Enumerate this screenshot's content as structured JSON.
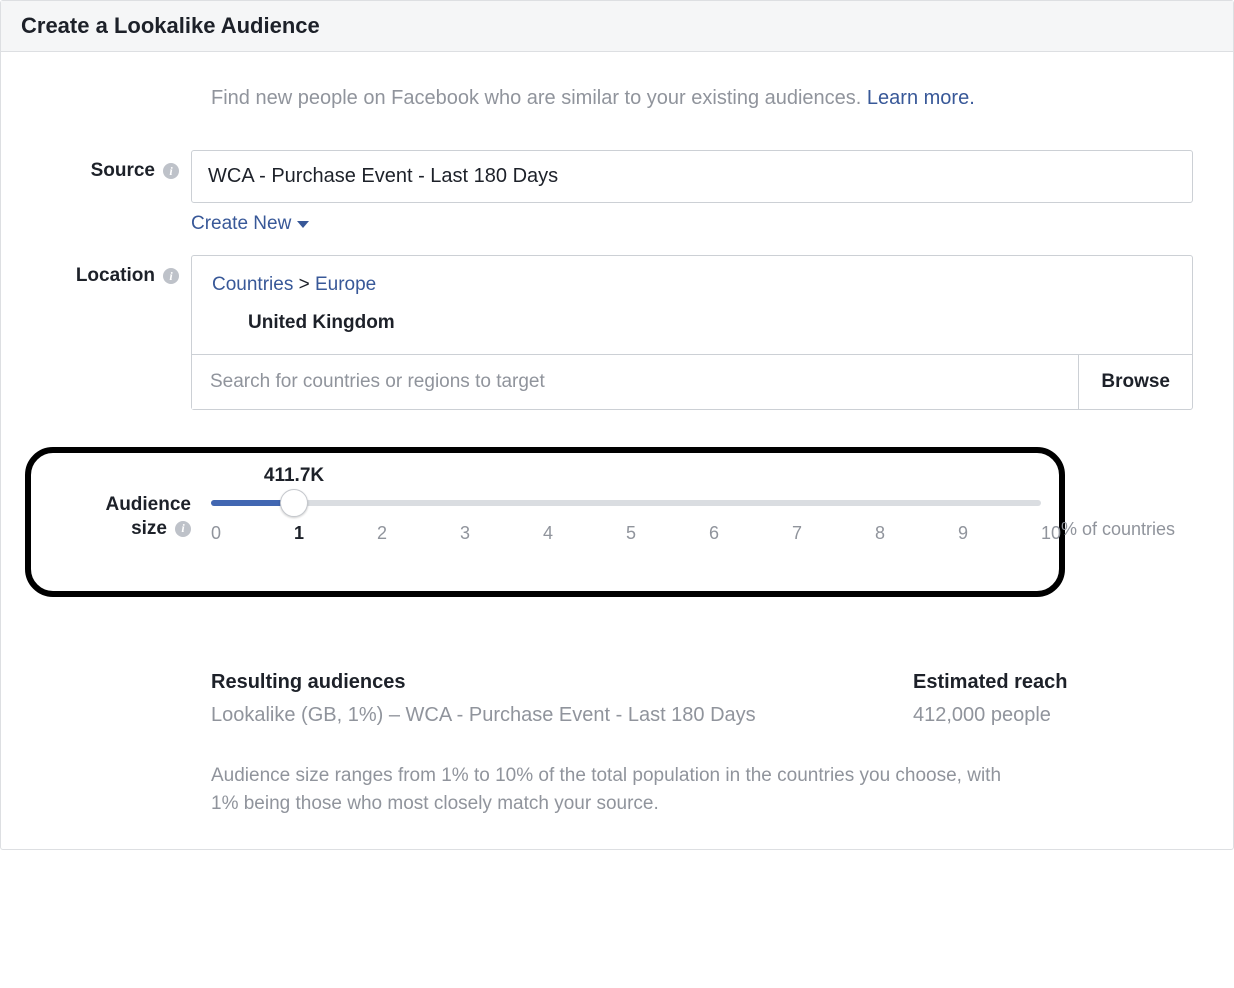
{
  "title": "Create a Lookalike Audience",
  "intro_text": "Find new people on Facebook who are similar to your existing audiences. ",
  "learn_more": "Learn more.",
  "labels": {
    "source": "Source",
    "location": "Location",
    "audience_size_l1": "Audience",
    "audience_size_l2": "size"
  },
  "source": {
    "value": "WCA - Purchase Event - Last 180 Days",
    "create_new": "Create New"
  },
  "location": {
    "breadcrumb_root": "Countries",
    "breadcrumb_region": "Europe",
    "selected_country": "United Kingdom",
    "search_placeholder": "Search for countries or regions to target",
    "browse": "Browse"
  },
  "slider": {
    "size_label": "411.7K",
    "ticks": [
      "0",
      "1",
      "2",
      "3",
      "4",
      "5",
      "6",
      "7",
      "8",
      "9",
      "10"
    ],
    "selected_index": 1,
    "pct_suffix": "% of countries"
  },
  "results": {
    "resulting_heading": "Resulting audiences",
    "resulting_value": "Lookalike (GB, 1%) – WCA - Purchase Event - Last 180 Days",
    "reach_heading": "Estimated reach",
    "reach_value": "412,000 people"
  },
  "disclaimer": "Audience size ranges from 1% to 10% of the total population in the countries you choose, with 1% being those who most closely match your source."
}
